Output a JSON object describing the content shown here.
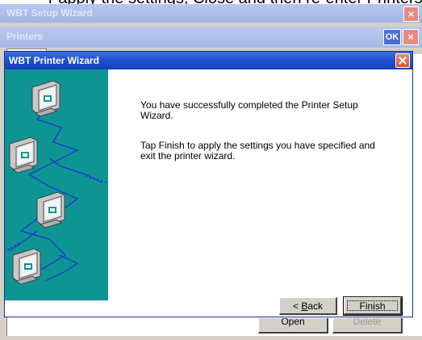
{
  "outer_window": {
    "top_caption": "r apply the settings, Close and then re-enter Printers",
    "title": "WBT Setup Wizard"
  },
  "printers_panel": {
    "title": "Printers",
    "ok_label": "OK",
    "bottom_buttons": [
      {
        "label": "Open"
      },
      {
        "label": "Delete"
      }
    ]
  },
  "wizard": {
    "title": "WBT Printer Wizard",
    "message_line1": "You have successfully completed the Printer Setup Wizard.",
    "message_line2": "Tap Finish to apply the settings you have specified and exit the printer wizard.",
    "back_label_prefix": "< ",
    "back_label_accel": "B",
    "back_label_rest": "ack",
    "finish_label": "Finish",
    "art_background": "#0e9593",
    "art_icon": "printer-network-icon"
  },
  "colors": {
    "titlebar": "#1f4fd0",
    "dialog_face": "#d4d0c8",
    "close_button": "#e0643e"
  }
}
